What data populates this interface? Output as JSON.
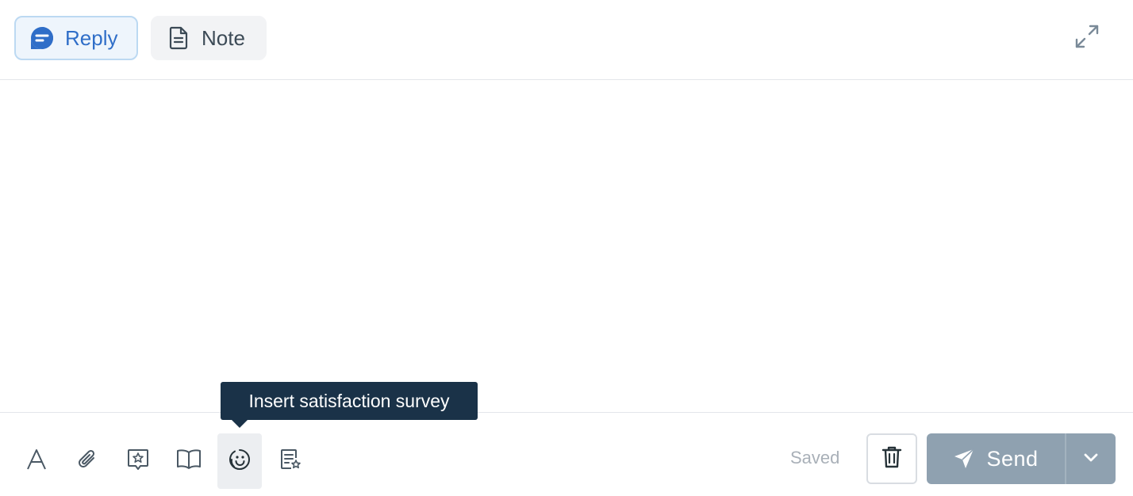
{
  "header": {
    "tabs": [
      {
        "label": "Reply",
        "icon": "chat-bubble-icon",
        "active": true
      },
      {
        "label": "Note",
        "icon": "document-icon",
        "active": false
      }
    ],
    "expand_icon": "expand-arrows-icon"
  },
  "editor": {
    "value": ""
  },
  "toolbar": {
    "tools": [
      {
        "icon": "text-format-icon"
      },
      {
        "icon": "paperclip-icon"
      },
      {
        "icon": "star-message-icon"
      },
      {
        "icon": "knowledge-base-book-icon"
      },
      {
        "icon": "satisfaction-survey-icon",
        "active": true
      },
      {
        "icon": "saved-reply-icon"
      }
    ],
    "tooltip": "Insert satisfaction survey",
    "saved_label": "Saved",
    "delete_icon": "trash-icon",
    "send_label": "Send",
    "send_icon": "paper-plane-icon",
    "send_menu_icon": "chevron-down-icon"
  },
  "colors": {
    "accent": "#2f6ec8",
    "tooltip_bg": "#1a3248",
    "send_bg": "#8fa1b0",
    "muted_text": "#a9b0b8"
  }
}
